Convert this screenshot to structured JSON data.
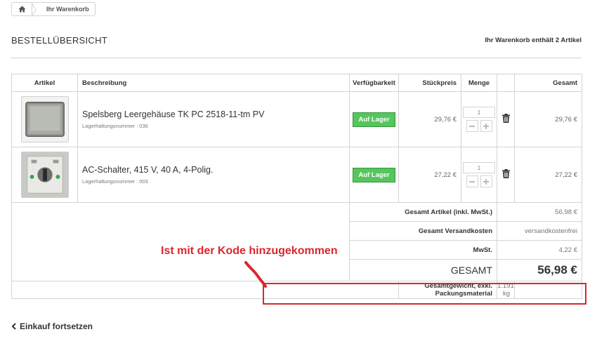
{
  "breadcrumb": {
    "home_icon": "home-icon",
    "current": "Ihr Warenkorb"
  },
  "heading": {
    "title": "BESTELLÜBERSICHT",
    "cart_count": "Ihr Warenkorb enthält 2 Artikel"
  },
  "table": {
    "headers": {
      "article": "Artikel",
      "description": "Beschreibung",
      "availability": "Verfügbarkeit",
      "unit_price": "Stückpreis",
      "quantity": "Menge",
      "total": "Gesamt"
    },
    "items": [
      {
        "name": "Spelsberg Leergehäuse TK PC 2518-11-tm PV",
        "reference": "Lagerhaltungsnummer : 036",
        "availability": "Auf Lager",
        "unit_price": "29,76 €",
        "quantity": "1",
        "total": "29,76 €"
      },
      {
        "name": "AC-Schalter, 415 V, 40 A, 4-Polig.",
        "reference": "Lagerhaltungsnummer : 003",
        "availability": "Auf Lager",
        "unit_price": "27,22 €",
        "quantity": "1",
        "total": "27,22 €"
      }
    ],
    "summary": {
      "products_label": "Gesamt Artikel (inkl. MwSt.)",
      "products_value": "56,98 €",
      "shipping_label": "Gesamt Versandkosten",
      "shipping_value": "versandkostenfrei",
      "tax_label": "MwSt.",
      "tax_value": "4,22 €",
      "total_label": "GESAMT",
      "total_value": "56,98 €",
      "weight_label": "Gesamtgewicht, exkl. Packungsmaterial",
      "weight_value": "1.191 kg"
    }
  },
  "annotation": {
    "text": "Ist mit der Kode hinzugekommen",
    "color": "#d9272d"
  },
  "footer": {
    "continue_label": "Einkauf fortsetzen"
  },
  "colors": {
    "stock_badge": "#55c65e",
    "border": "#d6d4d4"
  }
}
